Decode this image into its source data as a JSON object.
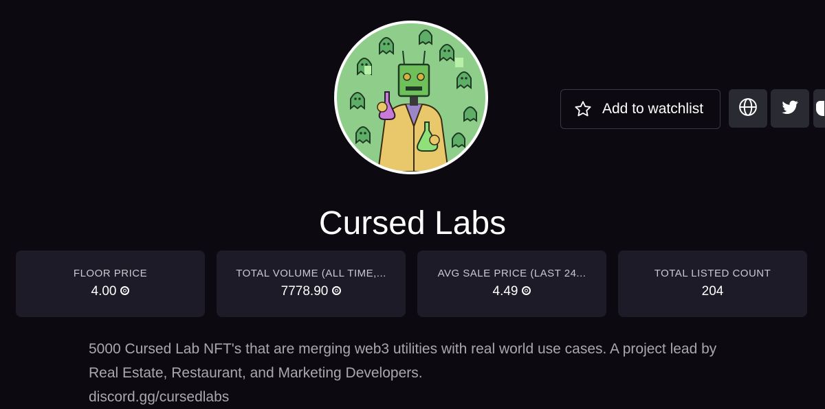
{
  "collection": {
    "name": "Cursed Labs",
    "description": "5000 Cursed Lab NFT's that are merging web3 utilities with real world use cases. A project lead by Real Estate, Restaurant, and Marketing Developers.",
    "link": "discord.gg/cursedlabs"
  },
  "actions": {
    "watchlist_label": "Add to watchlist",
    "watchlist_icon": "star-outline-icon",
    "website_icon": "globe-icon",
    "twitter_icon": "twitter-icon",
    "discord_icon": "discord-icon"
  },
  "stats": [
    {
      "label": "FLOOR PRICE",
      "value": "4.00",
      "unit_icon": "sol-icon"
    },
    {
      "label": "TOTAL VOLUME (ALL TIME,...",
      "value": "7778.90",
      "unit_icon": "sol-icon"
    },
    {
      "label": "AVG SALE PRICE (LAST 24...",
      "value": "4.49",
      "unit_icon": "sol-icon"
    },
    {
      "label": "TOTAL LISTED COUNT",
      "value": "204"
    }
  ],
  "colors": {
    "background": "#0c0a10",
    "card": "#1d1b28",
    "icon_button": "#2a2a32",
    "muted_text": "#a8a8ae",
    "avatar_green": "#8fce8a"
  }
}
